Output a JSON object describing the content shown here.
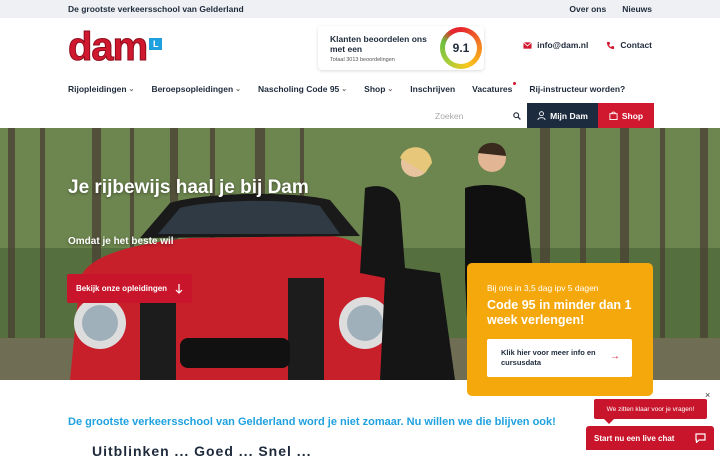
{
  "topbar": {
    "tagline": "De grootste verkeersschool van Gelderland",
    "links": [
      "Over ons",
      "Nieuws"
    ]
  },
  "logo": {
    "text": "dam",
    "badge": "L"
  },
  "rating": {
    "title": "Klanten beoordelen ons met een",
    "total": "Totaal 3013 beoordelingen",
    "score": "9.1"
  },
  "contact": {
    "email": "info@dam.nl",
    "phone_label": "Contact"
  },
  "nav": {
    "items": [
      {
        "label": "Rijopleidingen",
        "chevron": "⌄"
      },
      {
        "label": "Beroepsopleidingen",
        "chevron": "⌄"
      },
      {
        "label": "Nascholing Code 95",
        "chevron": "⌄"
      },
      {
        "label": "Shop",
        "chevron": "⌄"
      },
      {
        "label": "Inschrijven",
        "chevron": ""
      },
      {
        "label": "Vacatures",
        "chevron": ""
      },
      {
        "label": "Rij-instructeur worden?",
        "chevron": ""
      }
    ]
  },
  "search": {
    "placeholder": "Zoeken"
  },
  "account": {
    "mijn_label": "Mijn Dam",
    "shop_label": "Shop"
  },
  "hero": {
    "headline": "Je rijbewijs haal je bij Dam",
    "subline": "Omdat je het beste wil",
    "cta": "Bekijk onze opleidingen"
  },
  "promo": {
    "small": "Bij ons in 3,5 dag ipv 5 dagen",
    "title": "Code 95 in minder dan 1 week verlengen!",
    "button": "Klik hier voor meer info en cursusdata"
  },
  "main": {
    "tagline": "De grootste verkeersschool van Gelderland word je niet zomaar. Nu willen we die blijven ook!",
    "partial_heading": "Uitblinken ... Goed ... Snel ..."
  },
  "chat": {
    "bubble": "We zitten klaar voor je vragen!",
    "button": "Start nu een live chat",
    "close": "×"
  },
  "colors": {
    "brand_red": "#d0182f",
    "dark_blue": "#1d2b3f",
    "accent_blue": "#1fa1e0",
    "promo_orange": "#f5a80c"
  }
}
